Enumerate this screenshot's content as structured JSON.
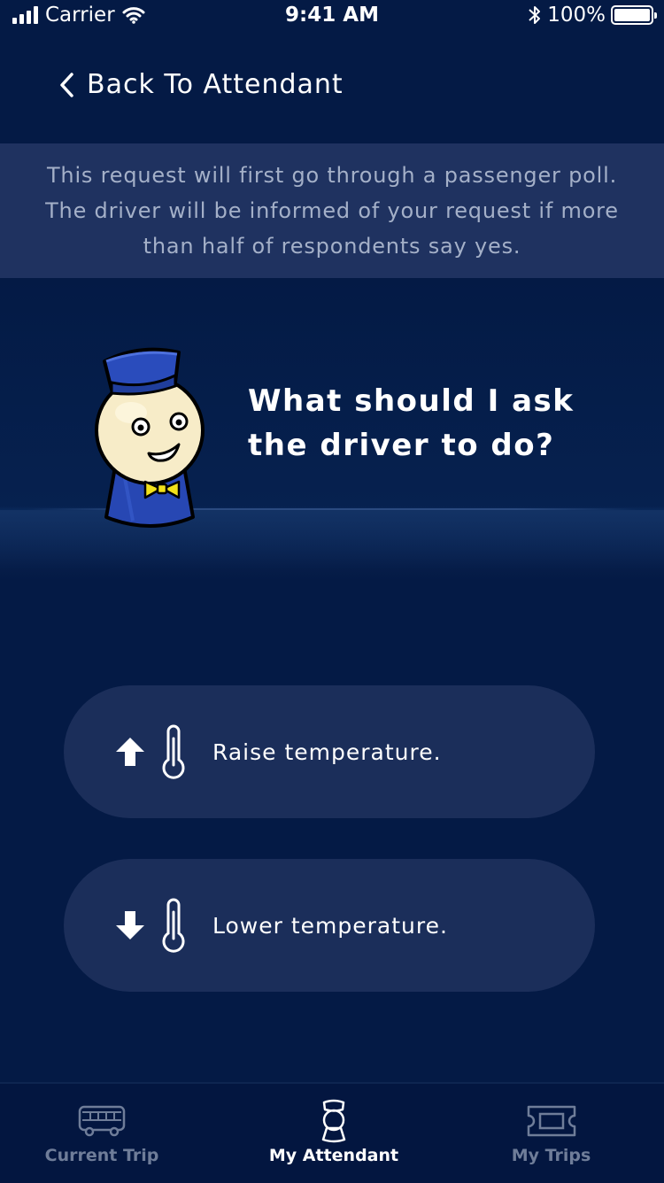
{
  "status_bar": {
    "carrier": "Carrier",
    "time": "9:41 AM",
    "battery": "100%"
  },
  "nav": {
    "back_label": "Back To Attendant"
  },
  "banner": {
    "text": "This request will first go through a passenger poll. The driver will be informed of your request if more than half of respondents say yes."
  },
  "attendant": {
    "question": "What should I ask the driver to do?"
  },
  "options": [
    {
      "label": "Raise temperature.",
      "arrow_icon": "arrow-up-icon",
      "icon": "thermometer-icon"
    },
    {
      "label": "Lower temperature.",
      "arrow_icon": "arrow-down-icon",
      "icon": "thermometer-icon"
    }
  ],
  "tabs": [
    {
      "label": "Current Trip",
      "icon": "bus-icon",
      "active": false
    },
    {
      "label": "My Attendant",
      "icon": "attendant-icon",
      "active": true
    },
    {
      "label": "My Trips",
      "icon": "ticket-icon",
      "active": false
    }
  ],
  "colors": {
    "background": "#041a45",
    "banner": "#1f3260",
    "option_button": "#1b2e5a",
    "tab_inactive": "#6f7d99",
    "accent_yellow": "#f3e21a",
    "hat_blue": "#2546b0"
  }
}
